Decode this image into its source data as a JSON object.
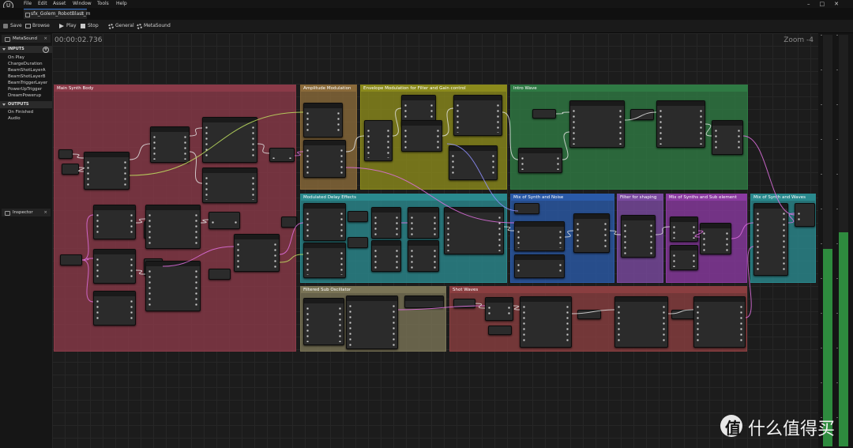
{
  "app_logo": "unreal-engine-logo",
  "menu": [
    "File",
    "Edit",
    "Asset",
    "Window",
    "Tools",
    "Help"
  ],
  "tab": {
    "title": "sfx_Golem_RobotBlast_m"
  },
  "toolbar": {
    "save": "Save",
    "browse": "Browse",
    "play": "Play",
    "stop": "Stop",
    "general": "General",
    "metasound": "MetaSound"
  },
  "left_panel": {
    "tab1": "MetaSound",
    "inputs_header": "INPUTS",
    "inputs": [
      "On Play",
      "ChargeDuration",
      "BeamShotLayerA",
      "BeamShotLayerB",
      "BeamTriggerLayer",
      "PowerUpTrigger",
      "DreamPowerup"
    ],
    "outputs_header": "OUTPUTS",
    "outputs": [
      "On Finished",
      "Audio"
    ],
    "tab2": "Inspector"
  },
  "graph": {
    "timecode": "00:00:02.736",
    "zoom": "Zoom -4",
    "comments": [
      {
        "title": "Main Synth Body",
        "color": "#8a3a48"
      },
      {
        "title": "Amplitude Modulation",
        "color": "#8a6a3a"
      },
      {
        "title": "Envelope Modulation for Filter and Gain control",
        "color": "#8b8a1c"
      },
      {
        "title": "Intro Wave",
        "color": "#2f7a44"
      },
      {
        "title": "Modulated Delay Effects",
        "color": "#2a8a8e"
      },
      {
        "title": "Mix of Synth and Noise",
        "color": "#2a5aa8"
      },
      {
        "title": "Filter for shaping",
        "color": "#7a4aa0"
      },
      {
        "title": "Mix of Synths and Sub element",
        "color": "#8a3aa0"
      },
      {
        "title": "Mix of Synth and Waves",
        "color": "#2a8a8e"
      },
      {
        "title": "Filtered Sub Oscillator",
        "color": "#7a7456"
      },
      {
        "title": "Shot Waves",
        "color": "#8a3e40"
      }
    ]
  },
  "meters": [
    {
      "name": "left-channel",
      "level": 0.48
    },
    {
      "name": "right-channel",
      "level": 0.52
    }
  ],
  "watermark": {
    "logo": "值",
    "text": "什么值得买"
  }
}
